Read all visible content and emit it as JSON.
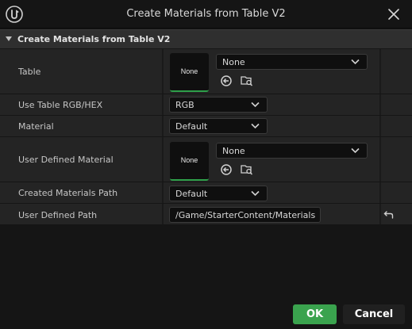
{
  "window": {
    "title": "Create Materials from Table V2"
  },
  "category": {
    "title": "Create Materials from Table V2"
  },
  "rows": {
    "table": {
      "label": "Table",
      "thumbnail_text": "None",
      "asset_value": "None"
    },
    "use_table_rgb_hex": {
      "label": "Use Table RGB/HEX",
      "value": "RGB"
    },
    "material": {
      "label": "Material",
      "value": "Default"
    },
    "user_defined_material": {
      "label": "User Defined Material",
      "thumbnail_text": "None",
      "asset_value": "None"
    },
    "created_materials_path": {
      "label": "Created Materials Path",
      "value": "Default"
    },
    "user_defined_path": {
      "label": "User Defined Path",
      "value": "/Game/StarterContent/Materials"
    }
  },
  "footer": {
    "ok_label": "OK",
    "cancel_label": "Cancel"
  },
  "colors": {
    "ok_button": "#3aa34e",
    "thumbnail_accent": "#2ea04a",
    "background": "#151515",
    "row_background": "#242424",
    "category_background": "#2f2f2f"
  },
  "icons": [
    "unreal-logo-icon",
    "close-icon",
    "collapse-arrow-icon",
    "chevron-down-icon",
    "use-selected-asset-icon",
    "browse-asset-icon",
    "reset-to-default-icon"
  ]
}
